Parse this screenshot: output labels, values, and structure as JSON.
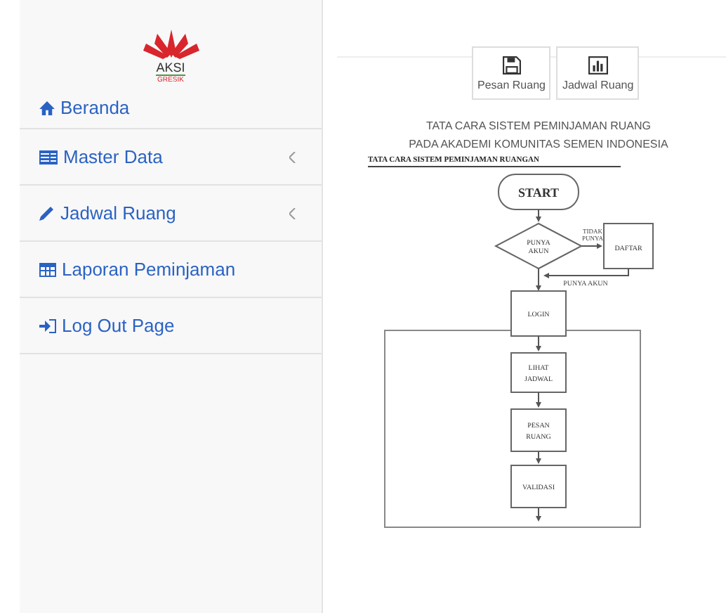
{
  "logo": {
    "name": "AKSI",
    "sub": "GRESIK"
  },
  "sidebar": {
    "items": [
      {
        "label": "Beranda",
        "submenu": false
      },
      {
        "label": "Master Data",
        "submenu": true
      },
      {
        "label": "Jadwal Ruang",
        "submenu": true
      },
      {
        "label": "Laporan Peminjaman",
        "submenu": false
      },
      {
        "label": "Log Out Page",
        "submenu": false
      }
    ]
  },
  "shortcuts": [
    {
      "label": "Pesan Ruang"
    },
    {
      "label": "Jadwal Ruang"
    }
  ],
  "heading": [
    "TATA CARA SISTEM PEMINJAMAN RUANG",
    "PADA AKADEMI KOMUNITAS SEMEN INDONESIA"
  ],
  "document": {
    "title": "TATA CARA SISTEM PEMINJAMAN RUANGAN",
    "flow": {
      "start": "START",
      "decision": "PUNYA AKUN",
      "no_label": "TIDAK PUNYA",
      "yes_label": "PUNYA AKUN",
      "register": "DAFTAR",
      "steps": [
        "LOGIN",
        "LIHAT JADWAL",
        "PESAN RUANG",
        "VALIDASI"
      ]
    }
  }
}
